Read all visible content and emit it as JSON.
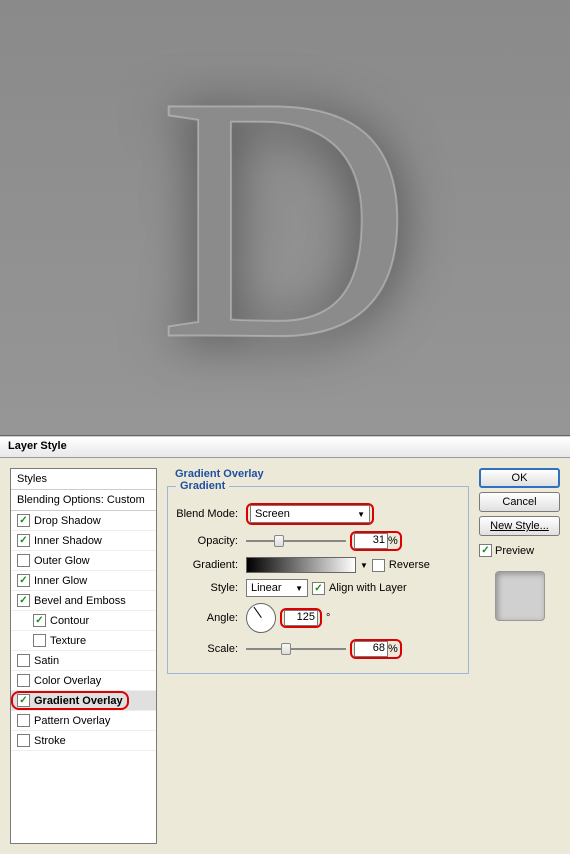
{
  "canvas": {
    "letter": "D"
  },
  "titlebar": "Layer Style",
  "styles": {
    "header": "Styles",
    "blending": "Blending Options: Custom",
    "items": [
      {
        "label": "Drop Shadow",
        "checked": true,
        "indent": false
      },
      {
        "label": "Inner Shadow",
        "checked": true,
        "indent": false
      },
      {
        "label": "Outer Glow",
        "checked": false,
        "indent": false
      },
      {
        "label": "Inner Glow",
        "checked": true,
        "indent": false
      },
      {
        "label": "Bevel and Emboss",
        "checked": true,
        "indent": false
      },
      {
        "label": "Contour",
        "checked": true,
        "indent": true
      },
      {
        "label": "Texture",
        "checked": false,
        "indent": true
      },
      {
        "label": "Satin",
        "checked": false,
        "indent": false
      },
      {
        "label": "Color Overlay",
        "checked": false,
        "indent": false
      },
      {
        "label": "Gradient Overlay",
        "checked": true,
        "indent": false,
        "selected": true,
        "highlight": true
      },
      {
        "label": "Pattern Overlay",
        "checked": false,
        "indent": false
      },
      {
        "label": "Stroke",
        "checked": false,
        "indent": false
      }
    ]
  },
  "panel": {
    "title": "Gradient Overlay",
    "fieldset": "Gradient",
    "blend_mode": {
      "label": "Blend Mode:",
      "value": "Screen"
    },
    "opacity": {
      "label": "Opacity:",
      "value": "31",
      "unit": "%"
    },
    "gradient": {
      "label": "Gradient:",
      "reverse": "Reverse"
    },
    "style": {
      "label": "Style:",
      "value": "Linear",
      "align": "Align with Layer"
    },
    "angle": {
      "label": "Angle:",
      "value": "125",
      "unit": "°"
    },
    "scale": {
      "label": "Scale:",
      "value": "68",
      "unit": "%"
    }
  },
  "buttons": {
    "ok": "OK",
    "cancel": "Cancel",
    "new_style": "New Style...",
    "preview": "Preview"
  }
}
